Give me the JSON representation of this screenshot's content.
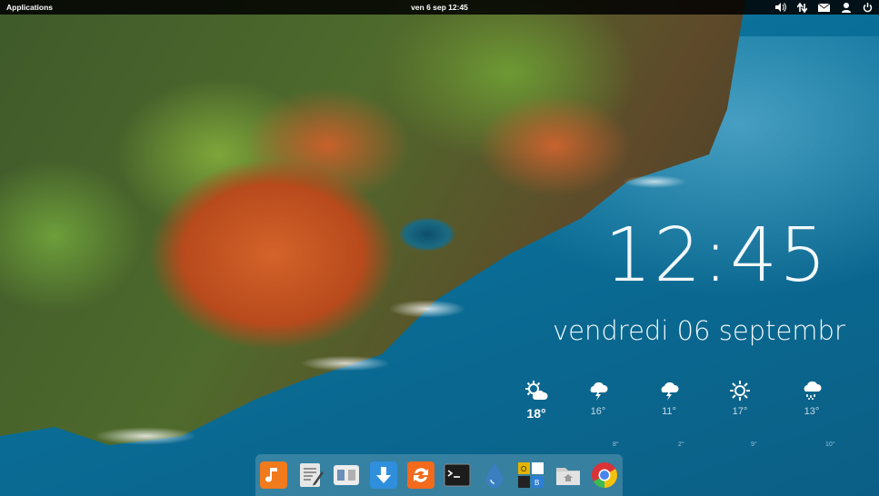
{
  "top_panel": {
    "applications_label": "Applications",
    "clock_label": "ven  6 sep 12:45",
    "tray_icons": [
      "volume-icon",
      "network-icon",
      "mail-icon",
      "user-icon",
      "power-icon"
    ]
  },
  "desktop_clock": {
    "time": "12:45",
    "date": "vendredi 06 septembr"
  },
  "weather": {
    "days": [
      {
        "icon": "partly-cloudy-icon",
        "temp": "18°",
        "low": ""
      },
      {
        "icon": "thunderstorm-icon",
        "temp": "16°",
        "low": "8°"
      },
      {
        "icon": "thunderstorm-icon",
        "temp": "11°",
        "low": "2°"
      },
      {
        "icon": "sunny-icon",
        "temp": "17°",
        "low": "9°"
      },
      {
        "icon": "rain-icon",
        "temp": "13°",
        "low": "10°"
      }
    ]
  },
  "dock": {
    "items": [
      {
        "name": "music-app",
        "color": "#f07a1c"
      },
      {
        "name": "text-editor",
        "color": "#d9d9d9"
      },
      {
        "name": "switchboard",
        "color": "#e0e0e0"
      },
      {
        "name": "downloads",
        "color": "#2f8fdd"
      },
      {
        "name": "software-update",
        "color": "#f26a1b"
      },
      {
        "name": "terminal",
        "color": "#222222"
      },
      {
        "name": "drop-app",
        "color": "#3a7fc0"
      },
      {
        "name": "office-suite",
        "color": "#f2c200"
      },
      {
        "name": "file-manager",
        "color": "#cfcfcf"
      },
      {
        "name": "chrome-browser",
        "color": "#db3236"
      }
    ]
  }
}
